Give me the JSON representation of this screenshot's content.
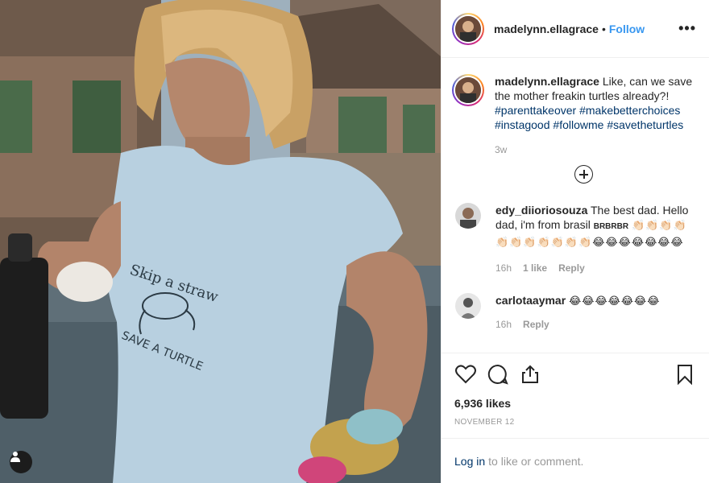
{
  "post": {
    "username": "madelynn.ellagrace",
    "separator": "•",
    "follow_label": "Follow",
    "more_label": "•••"
  },
  "caption": {
    "username": "madelynn.ellagrace",
    "text": "Like, can we save the mother freakin turtles already?!",
    "hashtags": [
      "#parenttakeover",
      "#makebetterchoices",
      "#instagood",
      "#followme",
      "#savetheturtles"
    ],
    "time": "3w"
  },
  "comments": [
    {
      "username": "edy_diioriosouza",
      "text": "The best dad. Hello dad, i'm from brasil",
      "suffix": "BRBRBR",
      "emoji": "👏🏻👏🏻👏🏻👏🏻👏🏻👏🏻👏🏻👏🏻👏🏻👏🏻👏🏻😂😂😂😂😂😂😂",
      "time": "16h",
      "likes": "1 like",
      "reply_label": "Reply"
    },
    {
      "username": "carlotaaymar",
      "text": "",
      "emoji": "😂😂😂😂😂😂😂",
      "time": "16h",
      "reply_label": "Reply"
    }
  ],
  "stats": {
    "likes": "6,936 likes",
    "date": "NOVEMBER 12"
  },
  "login": {
    "link_label": "Log in",
    "rest": "to like or comment."
  },
  "shirt_text": {
    "line1": "Skip a straw",
    "line2": "SAVE A TURTLE"
  },
  "icons": {
    "like": "heart-icon",
    "comment": "comment-bubble-icon",
    "share": "share-icon",
    "save": "bookmark-icon",
    "add": "plus-circle-icon",
    "tag": "user-tag-icon"
  }
}
